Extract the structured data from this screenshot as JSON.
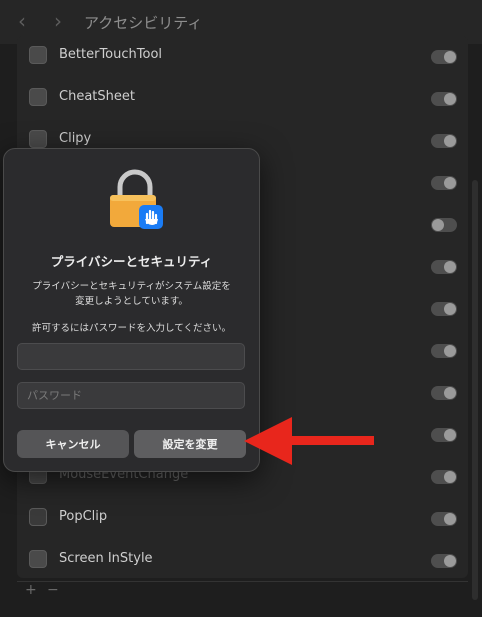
{
  "window": {
    "title": "アクセシビリティ",
    "back_glyph": "‹",
    "forward_glyph": "›"
  },
  "apps": [
    {
      "name": "BetterTouchTool",
      "enabled": true
    },
    {
      "name": "CheatSheet",
      "enabled": true
    },
    {
      "name": "Clipy",
      "enabled": true
    },
    {
      "name": "",
      "enabled": true
    },
    {
      "name": "",
      "enabled": false
    },
    {
      "name": "",
      "enabled": true
    },
    {
      "name": "",
      "enabled": true
    },
    {
      "name": "",
      "enabled": true
    },
    {
      "name": "",
      "enabled": true
    },
    {
      "name": "",
      "enabled": true
    },
    {
      "name": "MouseEventChange",
      "enabled": true
    },
    {
      "name": "PopClip",
      "enabled": true
    },
    {
      "name": "Screen InStyle",
      "enabled": true
    }
  ],
  "list_footer": {
    "add": "+",
    "remove": "−"
  },
  "dialog": {
    "title": "プライバシーとセキュリティ",
    "message_line1": "プライバシーとセキュリティがシステム設定を",
    "message_line2": "変更しようとしています。",
    "hint": "許可するにはパスワードを入力してください。",
    "username_value": "",
    "password_placeholder": "パスワード",
    "cancel_label": "キャンセル",
    "confirm_label": "設定を変更"
  },
  "colors": {
    "arrow": "#e8261c",
    "lock_body": "#f2a93b",
    "hand_badge": "#1a7cf5"
  }
}
